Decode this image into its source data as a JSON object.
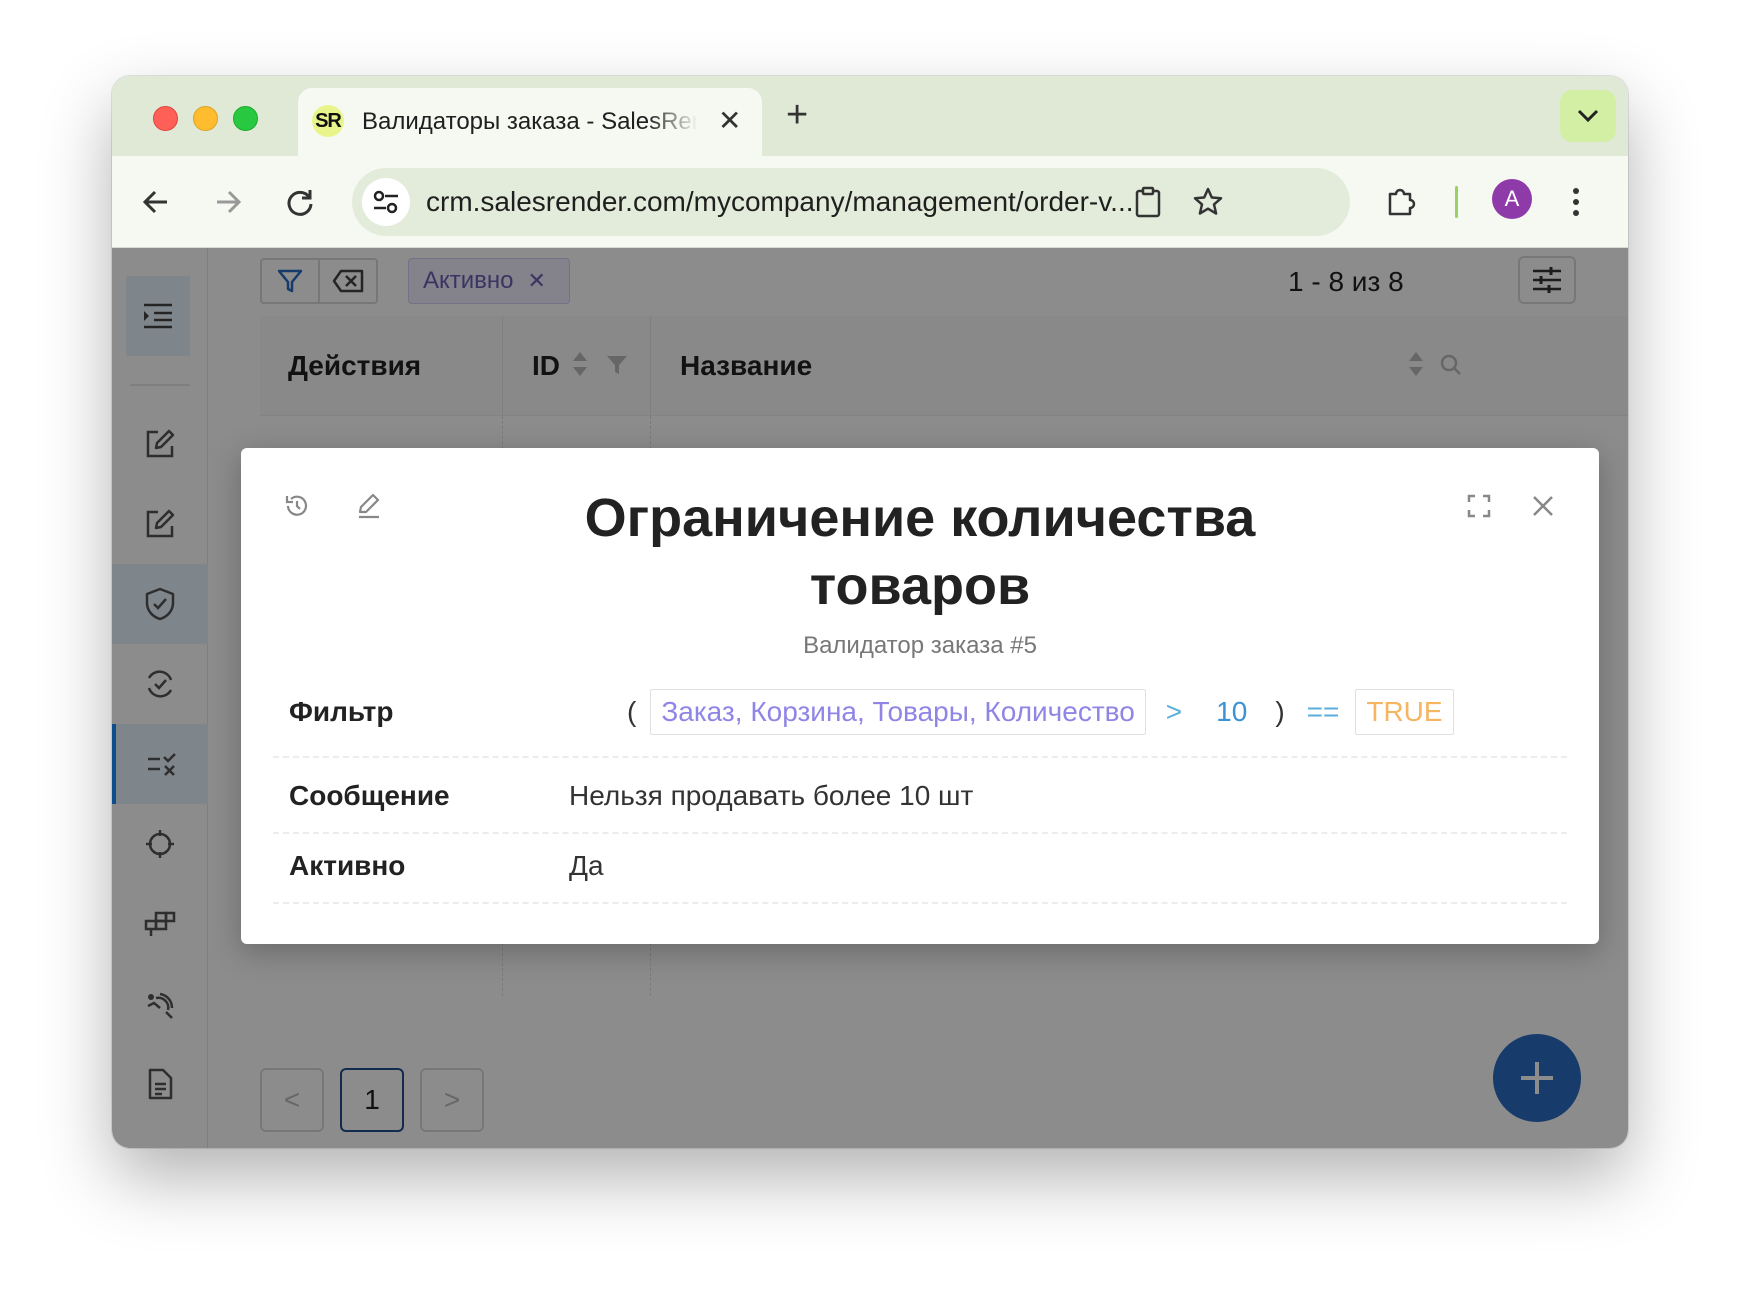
{
  "browser": {
    "tab_title": "Валидаторы заказа - SalesRender",
    "tab_favicon_text": "SR",
    "tab_close": "✕",
    "new_tab": "+",
    "url": "crm.salesrender.com/mycompany/management/order-v...",
    "avatar_letter": "A"
  },
  "list": {
    "filter_chip": "Активно",
    "chip_close": "✕",
    "pager_count": "1 - 8 из 8",
    "columns": [
      "Действия",
      "ID",
      "Название"
    ],
    "pagination": {
      "prev": "<",
      "current": "1",
      "next": ">"
    },
    "fab": "+"
  },
  "modal": {
    "title": "Ограничение количества товаров",
    "subtitle": "Валидатор заказа #5",
    "filter": {
      "label": "Фильтр",
      "open_paren": "(",
      "field": "Заказ, Корзина, Товары, Количество",
      "operator": ">",
      "value": "10",
      "close_paren": ")",
      "equals": "==",
      "bool": "TRUE"
    },
    "message": {
      "label": "Сообщение",
      "value": "Нельзя продавать более 10 шт"
    },
    "active": {
      "label": "Активно",
      "value": "Да"
    }
  },
  "colors": {
    "accent": "#1890ff",
    "fab": "#2a6cc4",
    "field_text": "#8f85e6",
    "operator": "#5aaedc",
    "number": "#3b93d6",
    "bool": "#f5b561",
    "tabstrip": "#dfe9d6"
  }
}
